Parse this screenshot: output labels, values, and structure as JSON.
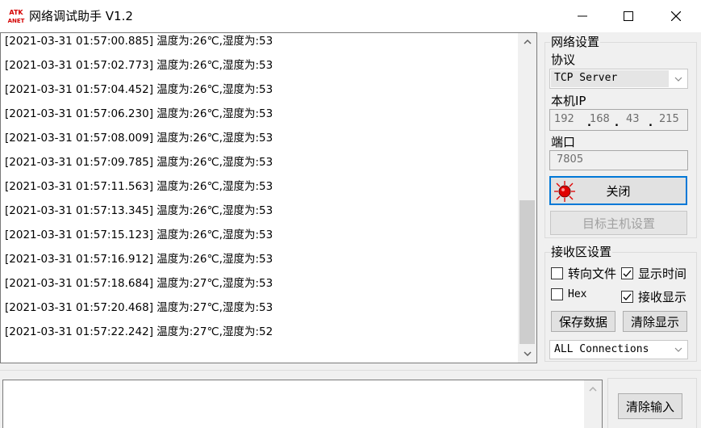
{
  "window": {
    "logo_text_top": "ATK",
    "logo_text_bottom": "ANET",
    "title": "网络调试助手 V1.2"
  },
  "receive": {
    "lines": [
      "[2021-03-31 01:57:00.885] 温度为:26℃,湿度为:53",
      "[2021-03-31 01:57:02.773] 温度为:26℃,湿度为:53",
      "[2021-03-31 01:57:04.452] 温度为:26℃,湿度为:53",
      "[2021-03-31 01:57:06.230] 温度为:26℃,湿度为:53",
      "[2021-03-31 01:57:08.009] 温度为:26℃,湿度为:53",
      "[2021-03-31 01:57:09.785] 温度为:26℃,湿度为:53",
      "[2021-03-31 01:57:11.563] 温度为:26℃,湿度为:53",
      "[2021-03-31 01:57:13.345] 温度为:26℃,湿度为:53",
      "[2021-03-31 01:57:15.123] 温度为:26℃,湿度为:53",
      "[2021-03-31 01:57:16.912] 温度为:26℃,湿度为:53",
      "[2021-03-31 01:57:18.684] 温度为:27℃,湿度为:53",
      "[2021-03-31 01:57:20.468] 温度为:27℃,湿度为:53",
      "[2021-03-31 01:57:22.242] 温度为:27℃,湿度为:52"
    ]
  },
  "network": {
    "group_title": "网络设置",
    "protocol_label": "协议",
    "protocol_value": "TCP Server",
    "ip_label": "本机IP",
    "ip": [
      "192",
      "168",
      "43",
      "215"
    ],
    "port_label": "端口",
    "port_value": "7805",
    "close_button": "关闭",
    "target_button": "目标主机设置"
  },
  "recv_settings": {
    "group_title": "接收区设置",
    "to_file": "转向文件",
    "to_file_checked": false,
    "show_time": "显示时间",
    "show_time_checked": true,
    "hex": "Hex",
    "hex_checked": false,
    "recv_show": "接收显示",
    "recv_show_checked": true,
    "save_button": "保存数据",
    "clear_button": "清除显示",
    "connections_value": "ALL Connections"
  },
  "send": {
    "clear_input_button": "清除输入"
  },
  "colors": {
    "accent": "#0078d7",
    "status_led": "#e00000"
  }
}
